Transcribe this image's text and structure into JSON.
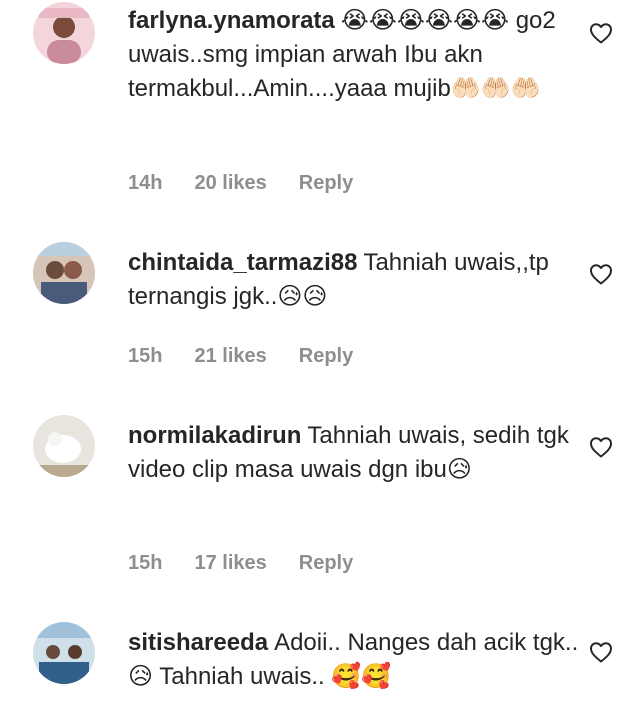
{
  "comments": [
    {
      "username": "farlyna.ynamorata",
      "text": "😭😭😭😭😭😭 go2 uwais..smg impian arwah Ibu akn termakbul...Amin....yaaa mujib🤲🏻🤲🏻🤲🏻",
      "time": "14h",
      "likes": "20 likes",
      "reply": "Reply",
      "avatar_icon": "user-avatar"
    },
    {
      "username": "chintaida_tarmazi88",
      "text": "Tahniah uwais,,tp ternangis jgk..😥😥",
      "time": "15h",
      "likes": "21 likes",
      "reply": "Reply",
      "avatar_icon": "user-avatar"
    },
    {
      "username": "normilakadirun",
      "text": "Tahniah uwais, sedih tgk video clip masa uwais dgn ibu😥",
      "time": "15h",
      "likes": "17 likes",
      "reply": "Reply",
      "avatar_icon": "user-avatar"
    },
    {
      "username": "sitishareeda",
      "text": "Adoii.. Nanges dah acik tgk.. 😥 Tahniah uwais.. 🥰🥰",
      "time": "",
      "likes": "",
      "reply": "",
      "avatar_icon": "user-avatar"
    }
  ],
  "colors": {
    "text": "#262626",
    "meta": "#8e8e8e",
    "heart_stroke": "#262626"
  }
}
